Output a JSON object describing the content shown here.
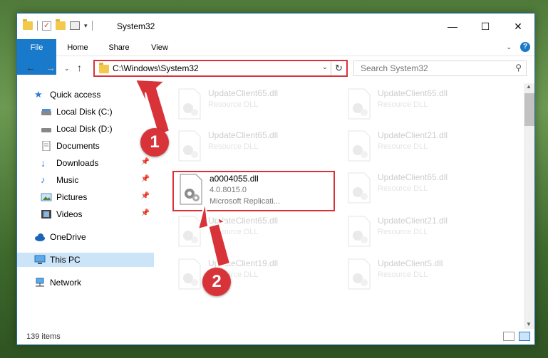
{
  "window": {
    "title": "System32",
    "minimize_glyph": "—",
    "maximize_glyph": "☐",
    "close_glyph": "✕"
  },
  "ribbon": {
    "tabs": [
      "File",
      "Home",
      "Share",
      "View"
    ]
  },
  "nav": {
    "address": "C:\\Windows\\System32",
    "search_placeholder": "Search System32"
  },
  "sidebar": {
    "items": [
      {
        "label": "Quick access",
        "icon": "star-icon",
        "pinned": false
      },
      {
        "label": "Local Disk (C:)",
        "icon": "drive-icon",
        "pinned": false
      },
      {
        "label": "Local Disk (D:)",
        "icon": "drive-icon",
        "pinned": false
      },
      {
        "label": "Documents",
        "icon": "documents-icon",
        "pinned": true
      },
      {
        "label": "Downloads",
        "icon": "download-icon",
        "pinned": true
      },
      {
        "label": "Music",
        "icon": "music-icon",
        "pinned": true
      },
      {
        "label": "Pictures",
        "icon": "pictures-icon",
        "pinned": true
      },
      {
        "label": "Videos",
        "icon": "videos-icon",
        "pinned": true
      },
      {
        "label": "OneDrive",
        "icon": "cloud-icon",
        "pinned": false
      },
      {
        "label": "This PC",
        "icon": "computer-icon",
        "pinned": false,
        "selected": true
      },
      {
        "label": "Network",
        "icon": "network-icon",
        "pinned": false
      }
    ]
  },
  "files": [
    {
      "name": "UpdateClient65.dll",
      "type": "Resource DLL"
    },
    {
      "name": "UpdateClient65.dll",
      "type": "Resource DLL"
    },
    {
      "name": "UpdateClient65.dll",
      "type": "Resource DLL"
    },
    {
      "name": "UpdateClient21.dll",
      "type": "Resource DLL"
    },
    {
      "name": "a0004055.dll",
      "version": "4.0.8015.0",
      "company": "Microsoft Replicati..."
    },
    {
      "name": "UpdateClient65.dll",
      "type": "Resource DLL"
    },
    {
      "name": "UpdateClient65.dll",
      "type": "Resource DLL"
    },
    {
      "name": "UpdateClient21.dll",
      "type": "Resource DLL"
    },
    {
      "name": "UpdateClient19.dll",
      "type": "Resource DLL"
    },
    {
      "name": "UpdateClient5.dll",
      "type": "Resource DLL"
    }
  ],
  "status": {
    "item_count": "139 items"
  },
  "annotations": {
    "step1": "1",
    "step2": "2",
    "color": "#d9333a"
  }
}
